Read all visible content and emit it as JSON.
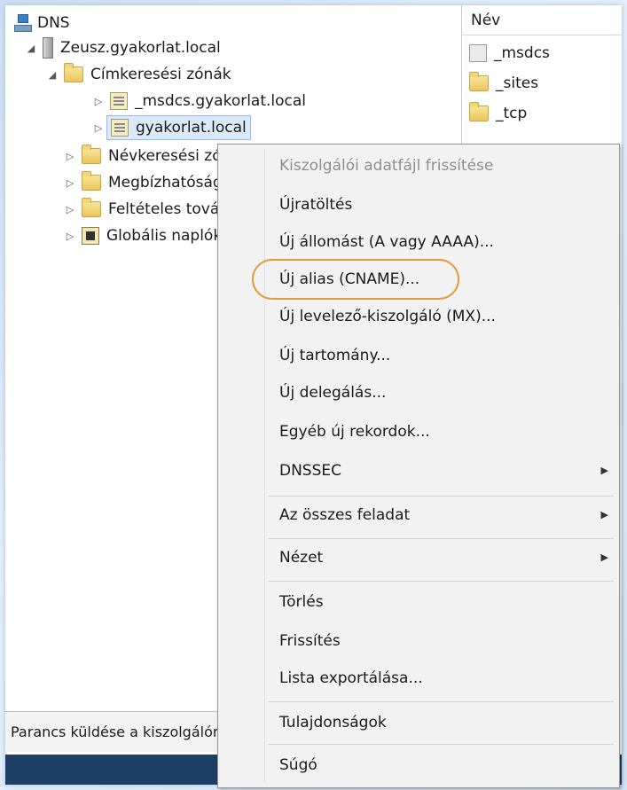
{
  "tree": {
    "root": "DNS",
    "server": "Zeusz.gyakorlat.local",
    "forward_zones": "Címkeresési zónák",
    "zone_msdcs": "_msdcs.gyakorlat.local",
    "zone_selected": "gyakorlat.local",
    "reverse_zones": "Névkeresési zónák",
    "trust_points": "Megbízhatósági pontok",
    "conditional": "Feltételes továbbítók",
    "global_logs": "Globális naplók"
  },
  "list": {
    "header": "Név",
    "items": [
      "_msdcs",
      "_sites",
      "_tcp"
    ]
  },
  "status": {
    "text": "Parancs küldése a kiszolgálónak"
  },
  "menu": {
    "refresh_zone_file": "Kiszolgálói adatfájl frissítése",
    "reload": "Újratöltés",
    "new_host": "Új állomást (A vagy AAAA)...",
    "new_alias": "Új alias (CNAME)...",
    "new_mx": "Új levelező-kiszolgáló (MX)...",
    "new_domain": "Új tartomány...",
    "new_delegation": "Új delegálás...",
    "other_records": "Egyéb új rekordok...",
    "dnssec": "DNSSEC",
    "all_tasks": "Az összes feladat",
    "view": "Nézet",
    "delete": "Törlés",
    "refresh": "Frissítés",
    "export_list": "Lista exportálása...",
    "properties": "Tulajdonságok",
    "help": "Súgó"
  },
  "colors": {
    "highlight": "#e49a3c",
    "selection": "#dbe9f8"
  }
}
